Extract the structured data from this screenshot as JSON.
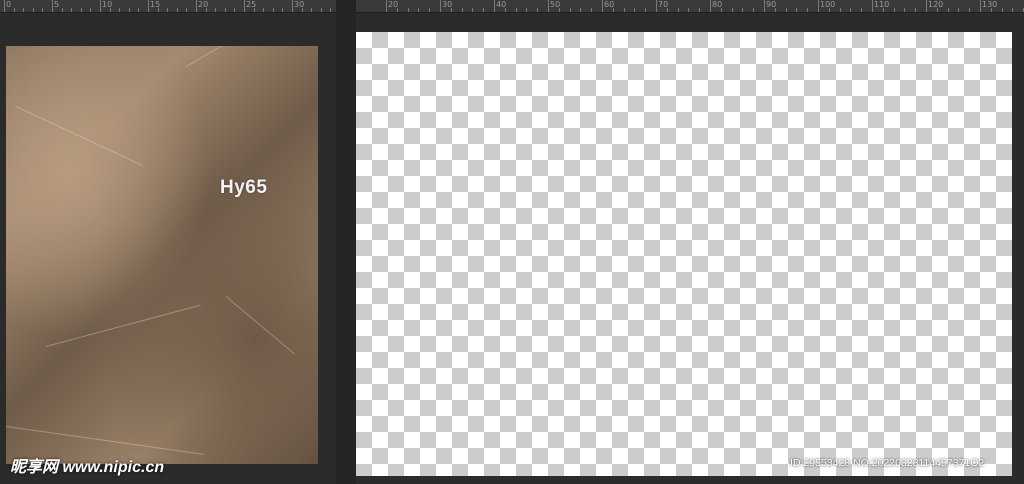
{
  "ruler_left": {
    "labels": [
      "0",
      "5",
      "10",
      "15",
      "20",
      "25",
      "30"
    ]
  },
  "ruler_right": {
    "labels": [
      "20",
      "30",
      "40",
      "50",
      "60",
      "70",
      "80",
      "90",
      "100",
      "110",
      "120",
      "130"
    ]
  },
  "product_tag": "Hy65",
  "watermark": {
    "logo": "昵享网",
    "url": "www.nipic.cn",
    "id_text": "ID:29553428 NO:20220328114457371O2"
  },
  "colors": {
    "workspace": "#2b2b2b",
    "pink_band": "#e8909a",
    "navy_band": "#3d4f7c",
    "olive_band": "#c5c99a",
    "rose_red": "#d0202e",
    "skirt_base": "#e4eef6",
    "waistband": "#1b1b1b"
  }
}
